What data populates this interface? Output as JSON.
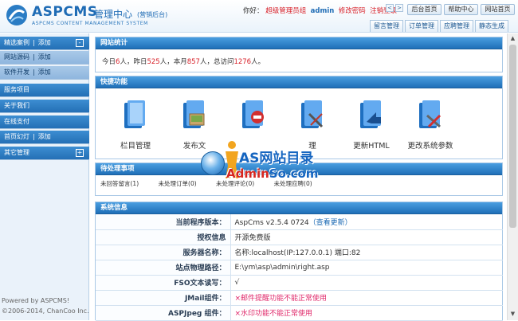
{
  "header": {
    "brand": "ASPCMS",
    "brand_subtitle": "管理中心",
    "brand_subtitle_small": "(营销后台)",
    "tagline": "ASPCMS CONTENT MANAGEMENT SYSTEM",
    "greeting": "你好：",
    "role": "超级管理员组",
    "user": "admin",
    "change_password": "修改密码",
    "logout": "注销登录",
    "nav_prev": "<",
    "nav_next": ">",
    "buttons": [
      "后台首页",
      "帮助中心",
      "网站首页"
    ],
    "subtabs": [
      "留言管理",
      "订单管理",
      "应聘管理",
      "静态生成"
    ]
  },
  "sidebar": {
    "items": [
      {
        "label": "精选案例",
        "action": "添加",
        "toggle": "-",
        "style": "dark"
      },
      {
        "label": "网站源码",
        "action": "添加",
        "style": "light"
      },
      {
        "label": "软件开发",
        "action": "添加",
        "style": "light"
      },
      {
        "label": "服务项目",
        "style": "dark"
      },
      {
        "label": "关于我们",
        "style": "dark"
      },
      {
        "label": "在线支付",
        "style": "dark"
      },
      {
        "label": "首页幻灯",
        "action": "添加",
        "style": "dark"
      },
      {
        "label": "其它管理",
        "toggle": "+",
        "style": "dark"
      }
    ],
    "footer_line1": "Powered by ASPCMS!",
    "footer_line2": "©2006-2014, ChanCoo Inc."
  },
  "stats": {
    "title": "网站统计",
    "today_label": "今日",
    "today": "6",
    "yesterday_label": "人，昨日",
    "yesterday": "525",
    "month_label": "人，本月",
    "month": "857",
    "total_label": "人，总访问",
    "total": "1276",
    "unit": "人。"
  },
  "quick": {
    "title": "快捷功能",
    "items": [
      {
        "label": "栏目管理",
        "icon": "folder-icon"
      },
      {
        "label": "发布文",
        "icon": "picture-folder-icon"
      },
      {
        "label": "",
        "icon": "stop-folder-icon"
      },
      {
        "label": "理",
        "icon": "tools-folder-icon"
      },
      {
        "label": "更新HTML",
        "icon": "arrow-folder-icon"
      },
      {
        "label": "更改系统参数",
        "icon": "wrench-folder-icon"
      }
    ]
  },
  "todo": {
    "title": "待处理事项",
    "items": [
      "未回答留言(1)",
      "未处理订单(0)",
      "未处理评论(0)",
      "未处理应聘(0)"
    ]
  },
  "sysinfo": {
    "title": "系统信息",
    "rows": [
      {
        "key": "当前程序版本：",
        "value": "AspCms v2.5.4 0724",
        "link": "（查看更新）"
      },
      {
        "key": "授权信息",
        "value": "开源免费版"
      },
      {
        "key": "服务器名称：",
        "value": "名称:localhost(IP:127.0.0.1) 端口:82"
      },
      {
        "key": "站点物理路径：",
        "value": "E:\\ym\\asp\\admin\\right.asp"
      },
      {
        "key": "FSO文本读写：",
        "value": "√"
      },
      {
        "key": "JMail组件：",
        "value": "×邮件提醒功能不能正常使用",
        "bad": true
      },
      {
        "key": "ASPJpeg 组件：",
        "value": "×水印功能不能正常使用",
        "bad": true
      }
    ]
  },
  "watermark": {
    "line1": "AS网站目录",
    "line2_red": "Admin",
    "line2_blue": "So.com"
  },
  "scroll": {
    "up": "▲",
    "down": "▼"
  },
  "colors": {
    "accent": "#1f6fb8",
    "alert": "#d8222a",
    "bad_value": "#e0286a"
  }
}
